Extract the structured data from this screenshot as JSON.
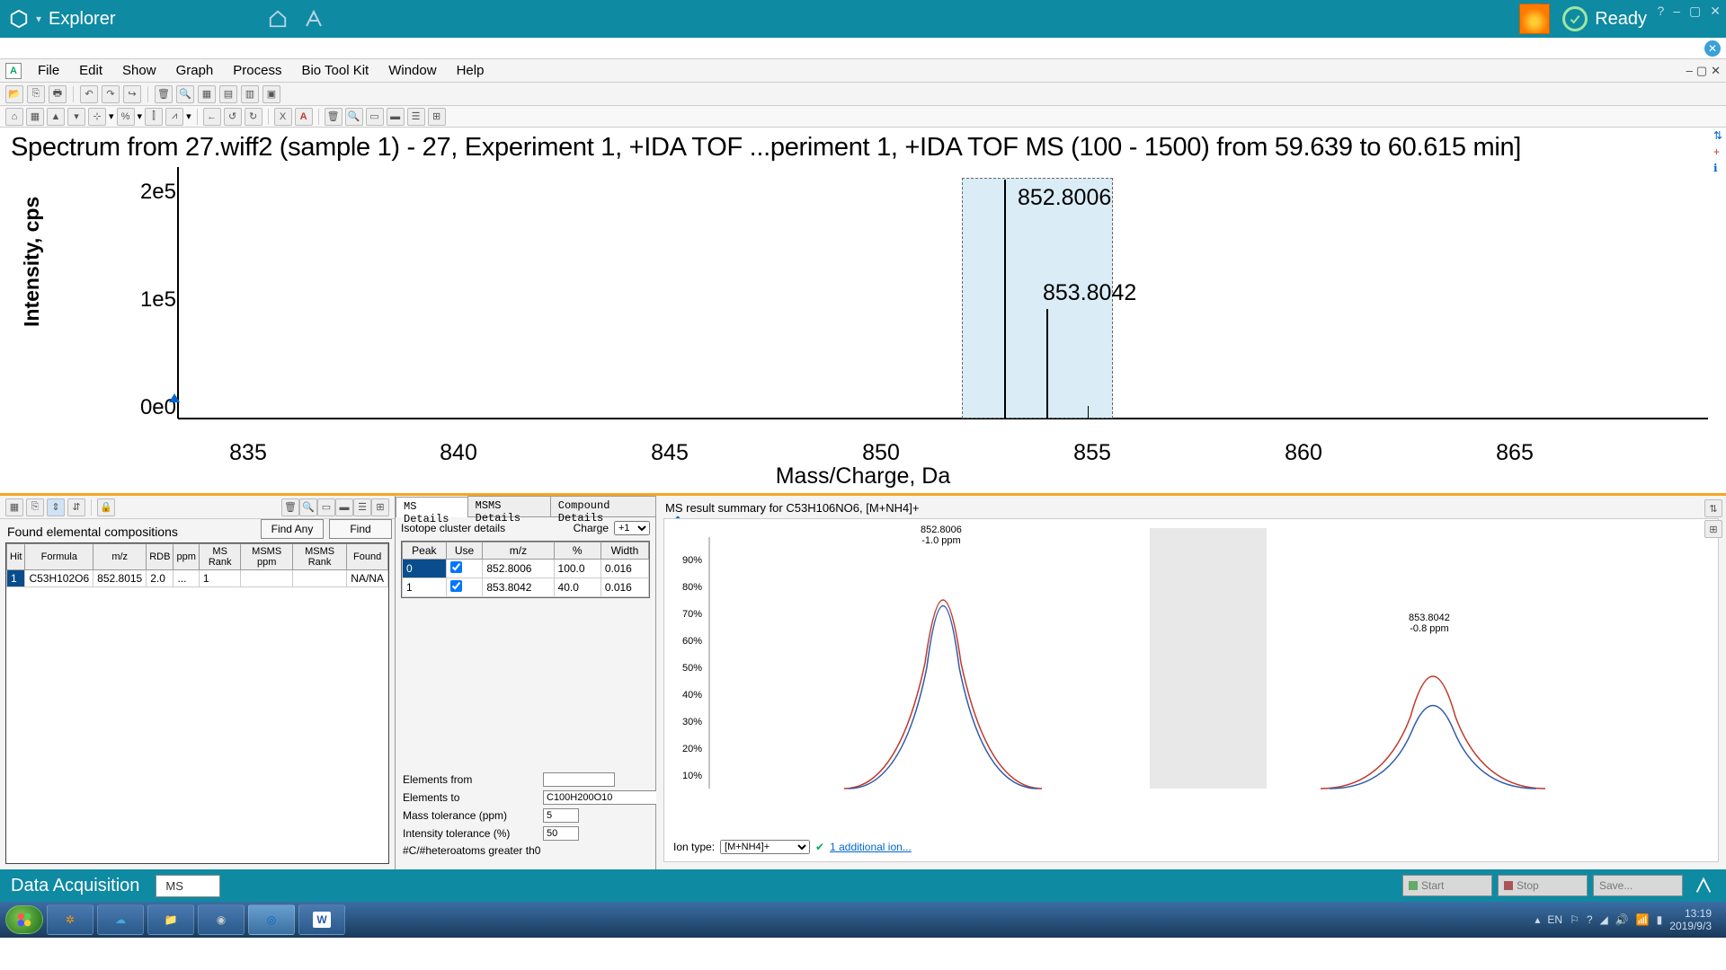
{
  "titlebar": {
    "app_name": "Explorer",
    "status": "Ready"
  },
  "menu": {
    "items": [
      "File",
      "Edit",
      "Show",
      "Graph",
      "Process",
      "Bio Tool Kit",
      "Window",
      "Help"
    ]
  },
  "spectrum": {
    "title": "Spectrum from 27.wiff2 (sample 1) - 27, Experiment 1, +IDA TOF ...periment 1, +IDA TOF MS (100 - 1500) from 59.639 to 60.615 min]",
    "y_label": "Intensity, cps",
    "x_label": "Mass/Charge, Da"
  },
  "chart_data": {
    "type": "bar",
    "title": "Spectrum from 27.wiff2 (sample 1) - 27, Experiment 1, +IDA TOF MS (100 - 1500) from 59.639 to 60.615 min",
    "xlabel": "Mass/Charge, Da",
    "ylabel": "Intensity, cps",
    "xlim": [
      832,
      870
    ],
    "ylim": [
      0,
      220000
    ],
    "x_ticks": [
      835,
      840,
      845,
      850,
      855,
      860,
      865
    ],
    "y_ticks": [
      "0e0",
      "1e5",
      "2e5"
    ],
    "peaks": [
      {
        "mz": 852.8006,
        "intensity": 210000,
        "label": "852.8006"
      },
      {
        "mz": 853.8042,
        "intensity": 95000,
        "label": "853.8042"
      }
    ],
    "selection": {
      "x0": 851.2,
      "x1": 855.2
    }
  },
  "left_panel": {
    "title": "Found elemental compositions",
    "find_any": "Find Any",
    "find": "Find",
    "headers": [
      "Hit",
      "Formula",
      "m/z",
      "RDB",
      "ppm",
      "MS Rank",
      "MSMS ppm",
      "MSMS Rank",
      "Found"
    ],
    "row": {
      "hit": "1",
      "formula": "C53H102O6",
      "mz": "852.8015",
      "rdb": "2.0",
      "ppm": "...",
      "ms_rank": "1",
      "msms_ppm": "",
      "msms_rank": "",
      "found": "NA/NA"
    }
  },
  "mid_panel": {
    "tabs": [
      "MS Details",
      "MSMS Details",
      "Compound Details"
    ],
    "iso_title": "Isotope cluster details",
    "charge_label": "Charge",
    "charge_value": "+1",
    "headers": [
      "Peak",
      "Use",
      "m/z",
      "%",
      "Width"
    ],
    "rows": [
      {
        "peak": "0",
        "use": true,
        "mz": "852.8006",
        "pct": "100.0",
        "width": "0.016"
      },
      {
        "peak": "1",
        "use": true,
        "mz": "853.8042",
        "pct": "40.0",
        "width": "0.016"
      }
    ],
    "form": {
      "elements_from_label": "Elements from",
      "elements_from": "",
      "elements_to_label": "Elements to",
      "elements_to": "C100H200O10",
      "mass_tol_label": "Mass tolerance (ppm)",
      "mass_tol": "5",
      "int_tol_label": "Intensity tolerance (%)",
      "int_tol": "50",
      "hetero_label": "#C/#heteroatoms greater th0"
    }
  },
  "right_panel": {
    "summary": "MS result summary for C53H106NO6, [M+NH4]+",
    "ion_type_label": "Ion type:",
    "ion_type": "[M+NH4]+",
    "additional_link": "1 additional ion...",
    "peak1": {
      "mz": "852.8006",
      "ppm": "-1.0 ppm"
    },
    "peak2": {
      "mz": "853.8042",
      "ppm": "-0.8 ppm"
    }
  },
  "bottombar": {
    "da": "Data Acquisition",
    "tab": "MS",
    "start": "Start",
    "stop": "Stop",
    "save": "Save..."
  },
  "taskbar": {
    "time": "13:19",
    "date": "2019/9/3"
  }
}
